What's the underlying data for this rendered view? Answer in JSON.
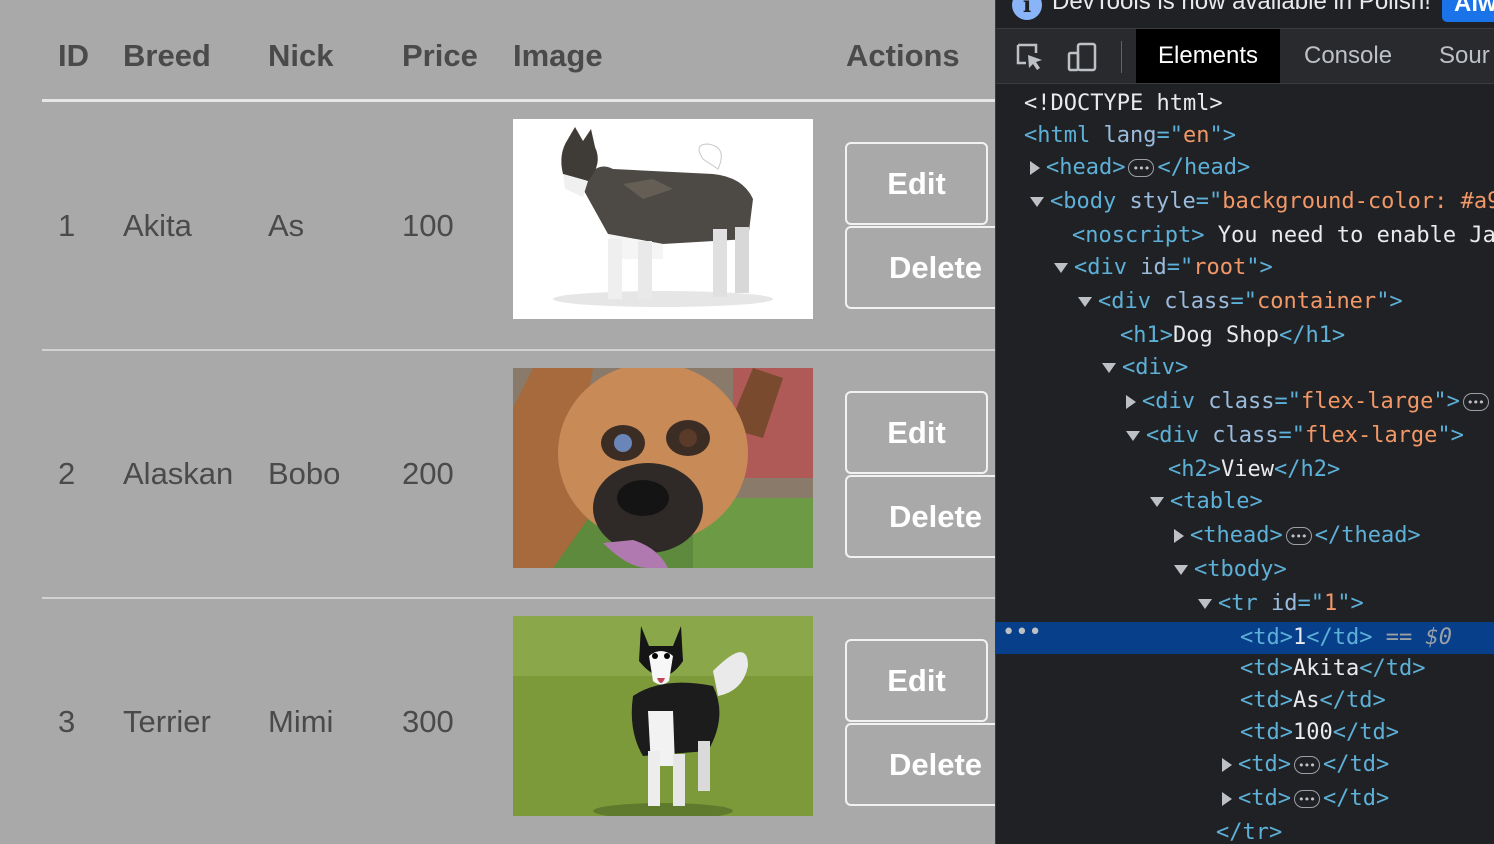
{
  "table": {
    "headers": [
      "ID",
      "Breed",
      "Nick",
      "Price",
      "Image",
      "Actions"
    ],
    "rows": [
      {
        "id": "1",
        "breed": "Akita",
        "nick": "As",
        "price": "100",
        "edit": "Edit",
        "delete": "Delete"
      },
      {
        "id": "2",
        "breed": "Alaskan",
        "nick": "Bobo",
        "price": "200",
        "edit": "Edit",
        "delete": "Delete"
      },
      {
        "id": "3",
        "breed": "Terrier",
        "nick": "Mimi",
        "price": "300",
        "edit": "Edit",
        "delete": "Delete"
      }
    ]
  },
  "devtools": {
    "notice": {
      "text": "DevTools is now available in Polish!",
      "button": "Alwa"
    },
    "tabs": [
      "Elements",
      "Console",
      "Sour"
    ],
    "active_tab": "Elements",
    "tree": [
      {
        "indent": 0,
        "tri": "",
        "parts": [
          [
            "tx",
            "<!DOCTYPE html>"
          ]
        ]
      },
      {
        "indent": 0,
        "tri": "",
        "parts": [
          [
            "tg",
            "<html "
          ],
          [
            "at",
            "lang"
          ],
          [
            "tg",
            "=\""
          ],
          [
            "av",
            "en"
          ],
          [
            "tg",
            "\">"
          ]
        ]
      },
      {
        "indent": 1,
        "tri": "closed",
        "parts": [
          [
            "tg",
            "<head>"
          ],
          [
            "ell",
            ""
          ],
          [
            "tg",
            "</head>"
          ]
        ]
      },
      {
        "indent": 1,
        "tri": "open",
        "parts": [
          [
            "tg",
            "<body "
          ],
          [
            "at",
            "style"
          ],
          [
            "tg",
            "=\""
          ],
          [
            "av",
            "background-color: #a9"
          ]
        ]
      },
      {
        "indent": 2,
        "tri": "",
        "parts": [
          [
            "tg",
            "<noscript>"
          ],
          [
            "tx",
            " You need to enable Ja"
          ]
        ]
      },
      {
        "indent": 2,
        "tri": "open",
        "parts": [
          [
            "tg",
            "<div "
          ],
          [
            "at",
            "id"
          ],
          [
            "tg",
            "=\""
          ],
          [
            "av",
            "root"
          ],
          [
            "tg",
            "\">"
          ]
        ]
      },
      {
        "indent": 3,
        "tri": "open",
        "parts": [
          [
            "tg",
            "<div "
          ],
          [
            "at",
            "class"
          ],
          [
            "tg",
            "=\""
          ],
          [
            "av",
            "container"
          ],
          [
            "tg",
            "\">"
          ]
        ]
      },
      {
        "indent": 4,
        "tri": "",
        "parts": [
          [
            "tg",
            "<h1>"
          ],
          [
            "tx",
            "Dog Shop"
          ],
          [
            "tg",
            "</h1>"
          ]
        ]
      },
      {
        "indent": 4,
        "tri": "open",
        "parts": [
          [
            "tg",
            "<div>"
          ]
        ]
      },
      {
        "indent": 5,
        "tri": "closed",
        "parts": [
          [
            "tg",
            "<div "
          ],
          [
            "at",
            "class"
          ],
          [
            "tg",
            "=\""
          ],
          [
            "av",
            "flex-large"
          ],
          [
            "tg",
            "\">"
          ],
          [
            "ell",
            ""
          ]
        ]
      },
      {
        "indent": 5,
        "tri": "open",
        "parts": [
          [
            "tg",
            "<div "
          ],
          [
            "at",
            "class"
          ],
          [
            "tg",
            "=\""
          ],
          [
            "av",
            "flex-large"
          ],
          [
            "tg",
            "\">"
          ]
        ]
      },
      {
        "indent": 6,
        "tri": "",
        "parts": [
          [
            "tg",
            "<h2>"
          ],
          [
            "tx",
            "View"
          ],
          [
            "tg",
            "</h2>"
          ]
        ]
      },
      {
        "indent": 6,
        "tri": "open",
        "parts": [
          [
            "tg",
            "<table>"
          ]
        ]
      },
      {
        "indent": 7,
        "tri": "closed",
        "parts": [
          [
            "tg",
            "<thead>"
          ],
          [
            "ell",
            ""
          ],
          [
            "tg",
            "</thead>"
          ]
        ]
      },
      {
        "indent": 7,
        "tri": "open",
        "parts": [
          [
            "tg",
            "<tbody>"
          ]
        ]
      },
      {
        "indent": 8,
        "tri": "open",
        "parts": [
          [
            "tg",
            "<tr "
          ],
          [
            "at",
            "id"
          ],
          [
            "tg",
            "=\""
          ],
          [
            "av",
            "1"
          ],
          [
            "tg",
            "\">"
          ]
        ]
      },
      {
        "indent": 9,
        "tri": "",
        "selected": true,
        "parts": [
          [
            "tg",
            "<td>"
          ],
          [
            "tx",
            "1"
          ],
          [
            "tg",
            "</td>"
          ],
          [
            "dim",
            " == $0"
          ]
        ]
      },
      {
        "indent": 9,
        "tri": "",
        "parts": [
          [
            "tg",
            "<td>"
          ],
          [
            "tx",
            "Akita"
          ],
          [
            "tg",
            "</td>"
          ]
        ]
      },
      {
        "indent": 9,
        "tri": "",
        "parts": [
          [
            "tg",
            "<td>"
          ],
          [
            "tx",
            "As"
          ],
          [
            "tg",
            "</td>"
          ]
        ]
      },
      {
        "indent": 9,
        "tri": "",
        "parts": [
          [
            "tg",
            "<td>"
          ],
          [
            "tx",
            "100"
          ],
          [
            "tg",
            "</td>"
          ]
        ]
      },
      {
        "indent": 9,
        "tri": "closed",
        "parts": [
          [
            "tg",
            "<td>"
          ],
          [
            "ell",
            ""
          ],
          [
            "tg",
            "</td>"
          ]
        ]
      },
      {
        "indent": 9,
        "tri": "closed",
        "parts": [
          [
            "tg",
            "<td>"
          ],
          [
            "ell",
            ""
          ],
          [
            "tg",
            "</td>"
          ]
        ]
      },
      {
        "indent": 8,
        "tri": "",
        "parts": [
          [
            "tg",
            "</tr>"
          ]
        ]
      }
    ]
  }
}
